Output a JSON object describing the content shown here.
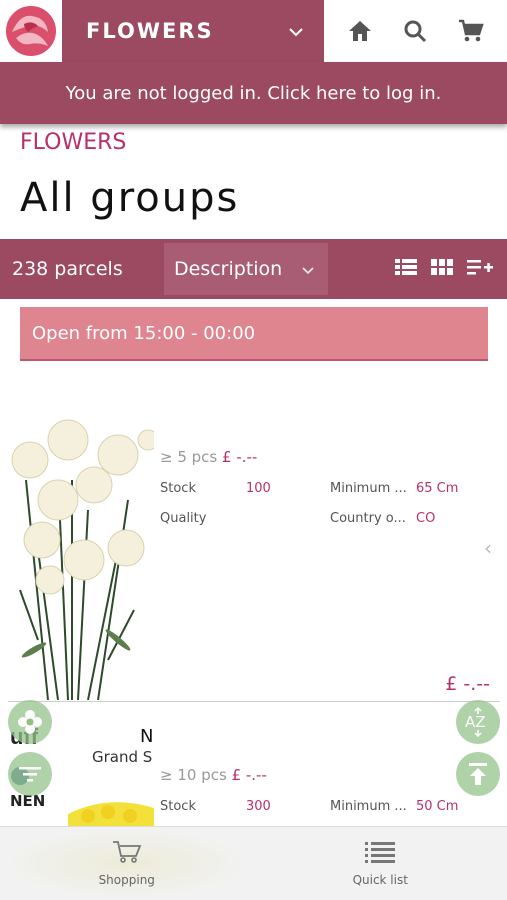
{
  "header": {
    "title": "FLOWERS",
    "icons": [
      "home-icon",
      "search-icon",
      "cart-icon"
    ]
  },
  "login_banner": "You are not logged in. Click here to log in.",
  "breadcrumb": "FLOWERS",
  "page_title": "All groups",
  "toolbar": {
    "count": "238 parcels",
    "sort": "Description"
  },
  "open_banner": "Open from 15:00 - 00:00",
  "products": [
    {
      "price_qty": "≥ 5 pcs",
      "price": "£ -.--",
      "stock_label": "Stock",
      "stock": "100",
      "min_label": "Minimum ...",
      "min": "65 Cm",
      "quality_label": "Quality",
      "country_label": "Country o...",
      "country": "CO",
      "total_price": "£ -.--"
    },
    {
      "name_fragment": "N",
      "name_line2": "Grand S",
      "price_qty": "≥ 10 pcs",
      "price": "£ -.--",
      "stock_label": "Stock",
      "stock": "300",
      "min_label": "Minimum ...",
      "min": "50 Cm",
      "logo_text": "NEN"
    }
  ],
  "nav": {
    "shopping": "Shopping",
    "quick_list": "Quick list"
  },
  "colors": {
    "brand": "#9b4a62",
    "accent": "#b8306a",
    "banner": "#de8590"
  }
}
